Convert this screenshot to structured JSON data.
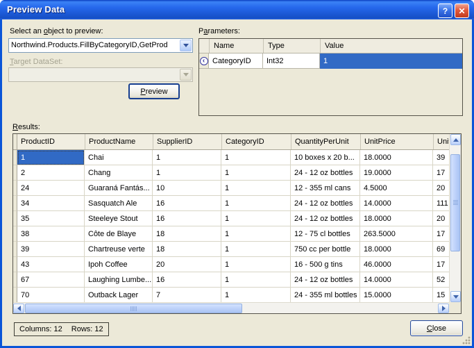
{
  "window": {
    "title": "Preview Data"
  },
  "titlebar": {
    "help_glyph": "?",
    "close_glyph": "✕"
  },
  "object_select": {
    "label": {
      "pre": "Select an ",
      "key": "o",
      "post": "bject to preview:"
    },
    "value": "Northwind.Products.FillByCategoryID,GetProd"
  },
  "target_dataset": {
    "label": {
      "pre": "",
      "key": "T",
      "post": "arget DataSet:"
    },
    "value": ""
  },
  "buttons": {
    "preview": {
      "key": "P",
      "rest": "review"
    },
    "close": {
      "key": "C",
      "rest": "lose"
    }
  },
  "parameters": {
    "label": {
      "pre": "P",
      "key": "a",
      "post": "rameters:"
    },
    "columns": [
      "Name",
      "Type",
      "Value"
    ],
    "row_indicator_glyph": "‹",
    "rows": [
      {
        "name": "CategoryID",
        "type": "Int32",
        "value": "1"
      }
    ]
  },
  "results": {
    "label": {
      "pre": "",
      "key": "R",
      "post": "esults:"
    },
    "columns": [
      "ProductID",
      "ProductName",
      "SupplierID",
      "CategoryID",
      "QuantityPerUnit",
      "UnitPrice",
      "UnitsI"
    ],
    "selected_cell": {
      "row": 0,
      "col": 0
    },
    "rows": [
      [
        "1",
        "Chai",
        "1",
        "1",
        "10 boxes x 20 b...",
        "18.0000",
        "39"
      ],
      [
        "2",
        "Chang",
        "1",
        "1",
        "24 - 12 oz bottles",
        "19.0000",
        "17"
      ],
      [
        "24",
        "Guaraná Fantás...",
        "10",
        "1",
        "12 - 355 ml cans",
        "4.5000",
        "20"
      ],
      [
        "34",
        "Sasquatch Ale",
        "16",
        "1",
        "24 - 12 oz bottles",
        "14.0000",
        "111"
      ],
      [
        "35",
        "Steeleye Stout",
        "16",
        "1",
        "24 - 12 oz bottles",
        "18.0000",
        "20"
      ],
      [
        "38",
        "Côte de Blaye",
        "18",
        "1",
        "12 - 75 cl bottles",
        "263.5000",
        "17"
      ],
      [
        "39",
        "Chartreuse verte",
        "18",
        "1",
        "750 cc per bottle",
        "18.0000",
        "69"
      ],
      [
        "43",
        "Ipoh Coffee",
        "20",
        "1",
        "16 - 500 g tins",
        "46.0000",
        "17"
      ],
      [
        "67",
        "Laughing Lumbe...",
        "16",
        "1",
        "24 - 12 oz bottles",
        "14.0000",
        "52"
      ],
      [
        "70",
        "Outback Lager",
        "7",
        "1",
        "24 - 355 ml bottles",
        "15.0000",
        "15"
      ]
    ]
  },
  "status": {
    "columns_text": "Columns: 12",
    "rows_text": "Rows: 12"
  },
  "colors": {
    "dialog_bg": "#ECE9D8",
    "titlebar_blue": "#2262E2",
    "selection_blue": "#316AC5",
    "close_button_red": "#D8492A"
  }
}
